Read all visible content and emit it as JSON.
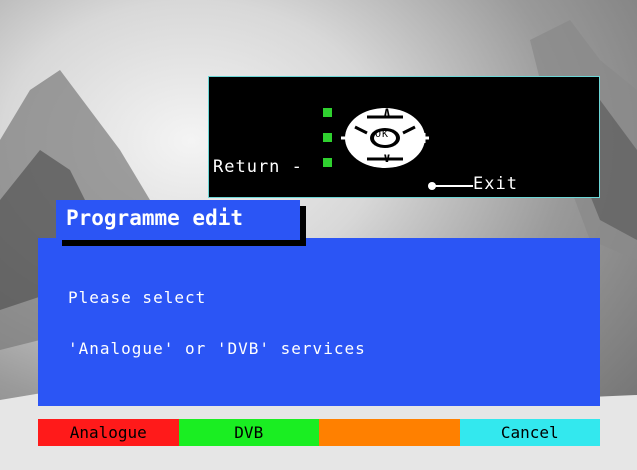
{
  "help": {
    "return_label": "Return -",
    "ok_label": "OK",
    "exit_label": "Exit",
    "up_symbol": "∧",
    "down_symbol": "∨",
    "minus_symbol": "−",
    "plus_symbol": "+"
  },
  "dialog": {
    "title": "Programme edit",
    "line1": "Please select",
    "line2": "'Analogue' or 'DVB' services"
  },
  "buttons": {
    "red_label": "Analogue",
    "green_label": "DVB",
    "yellow_label": "",
    "blue_label": "Cancel"
  },
  "colors": {
    "panel_blue": "#2b55f5",
    "red": "#ff1a1a",
    "green": "#1aee22",
    "yellow": "#ff8000",
    "cyan": "#33e8ee"
  }
}
